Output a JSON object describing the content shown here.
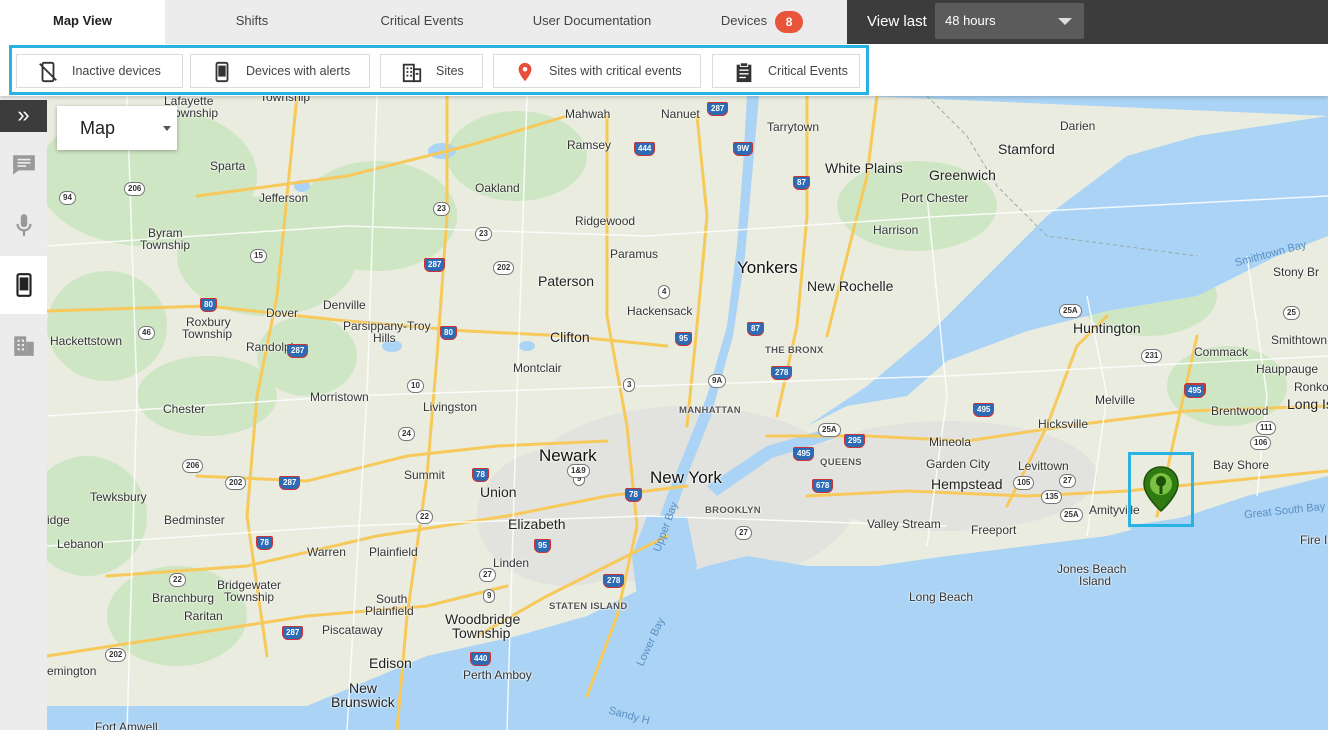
{
  "tabs": [
    {
      "label": "Map View"
    },
    {
      "label": "Shifts"
    },
    {
      "label": "Critical Events"
    },
    {
      "label": "User Documentation"
    },
    {
      "label": "Devices",
      "badge": "8"
    }
  ],
  "view_last": {
    "label": "View last",
    "value": "48 hours"
  },
  "filters": [
    {
      "label": "Inactive devices",
      "icon": "phone-off-icon"
    },
    {
      "label": "Devices with alerts",
      "icon": "phone-icon"
    },
    {
      "label": "Sites",
      "icon": "building-icon"
    },
    {
      "label": "Sites with critical events",
      "icon": "location-pin-icon"
    },
    {
      "label": "Critical Events",
      "icon": "clipboard-icon"
    }
  ],
  "sidebar": {
    "expand": "»",
    "items": [
      "message-icon",
      "microphone-icon",
      "phone-icon",
      "building-icon"
    ]
  },
  "map": {
    "type_label": "Map",
    "places": {
      "lafayette": "Lafayette",
      "lafayette2": "Township",
      "township": "Township",
      "mahwah": "Mahwah",
      "nanuet": "Nanuet",
      "tarrytown": "Tarrytown",
      "darien": "Darien",
      "ramsey": "Ramsey",
      "sparta": "Sparta",
      "white_plains": "White Plains",
      "stamford": "Stamford",
      "greenwich": "Greenwich",
      "jefferson": "Jefferson",
      "oakland": "Oakland",
      "port_chester": "Port Chester",
      "byram": "Byram",
      "byram2": "Township",
      "ridgewood": "Ridgewood",
      "harrison": "Harrison",
      "paramus": "Paramus",
      "yonkers": "Yonkers",
      "smithtown_bay": "Smithtown Bay",
      "stony_brook": "Stony Br",
      "paterson": "Paterson",
      "new_rochelle": "New Rochelle",
      "denville": "Denville",
      "dover": "Dover",
      "hackensack": "Hackensack",
      "roxbury": "Roxbury",
      "roxbury2": "Township",
      "parsippany": "Parsippany-Troy",
      "parsippany2": "Hills",
      "clifton": "Clifton",
      "huntington": "Huntington",
      "smithtown": "Smithtown",
      "hackettstown": "Hackettstown",
      "randolph": "Randolph",
      "the_bronx": "THE BRONX",
      "commack": "Commack",
      "hauppauge": "Hauppauge",
      "montclair": "Montclair",
      "ronko": "Ronko",
      "chester": "Chester",
      "morristown": "Morristown",
      "livingston": "Livingston",
      "melville": "Melville",
      "long_is": "Long Is",
      "manhattan": "MANHATTAN",
      "brentwood": "Brentwood",
      "hicksville": "Hicksville",
      "mineola": "Mineola",
      "newark": "Newark",
      "queens": "QUEENS",
      "garden_city": "Garden City",
      "levittown": "Levittown",
      "bay_shore": "Bay Shore",
      "summit": "Summit",
      "new_york": "New York",
      "hempstead": "Hempstead",
      "tewksbury": "Tewksbury",
      "union": "Union",
      "amityville": "Amityville",
      "great_south_bay": "Great South Bay",
      "bedminster": "Bedminster",
      "ridge": "idge",
      "elizabeth": "Elizabeth",
      "brooklyn": "BROOKLYN",
      "valley_stream": "Valley Stream",
      "freeport": "Freeport",
      "upper_bay": "Upper Bay",
      "lebanon": "Lebanon",
      "warren": "Warren",
      "plainfield": "Plainfield",
      "fire_island": "Fire Isla",
      "linden": "Linden",
      "jones_beach": "Jones Beach",
      "jones_beach2": "Island",
      "bridgewater": "Bridgewater",
      "bridgewater2": "Township",
      "branchburg": "Branchburg",
      "south_plainfield": "South",
      "south_plainfield2": "Plainfield",
      "staten_island": "STATEN ISLAND",
      "long_beach": "Long Beach",
      "raritan": "Raritan",
      "woodbridge": "Woodbridge",
      "woodbridge2": "Township",
      "piscataway": "Piscataway",
      "lower_bay": "Lower Bay",
      "edison": "Edison",
      "emington": "emington",
      "perth_amboy": "Perth Amboy",
      "new_brunswick": "New",
      "new_brunswick2": "Brunswick",
      "sandy_hook": "Sandy H",
      "fort_amwell": "Fort Amwell"
    },
    "route_shields": [
      "287",
      "444",
      "9W",
      "206",
      "87",
      "94",
      "23",
      "23",
      "287",
      "202",
      "15",
      "80",
      "80",
      "46",
      "87",
      "287",
      "4",
      "95",
      "10",
      "3",
      "278",
      "9A",
      "495",
      "24",
      "206",
      "202",
      "287",
      "78",
      "9",
      "22",
      "78",
      "1&9",
      "78",
      "95",
      "27",
      "278",
      "22",
      "9",
      "278",
      "287",
      "202",
      "440",
      "27",
      "295",
      "678",
      "495",
      "25A",
      "25A",
      "25",
      "231",
      "495",
      "111",
      "106",
      "105",
      "135",
      "27",
      "25A"
    ]
  }
}
